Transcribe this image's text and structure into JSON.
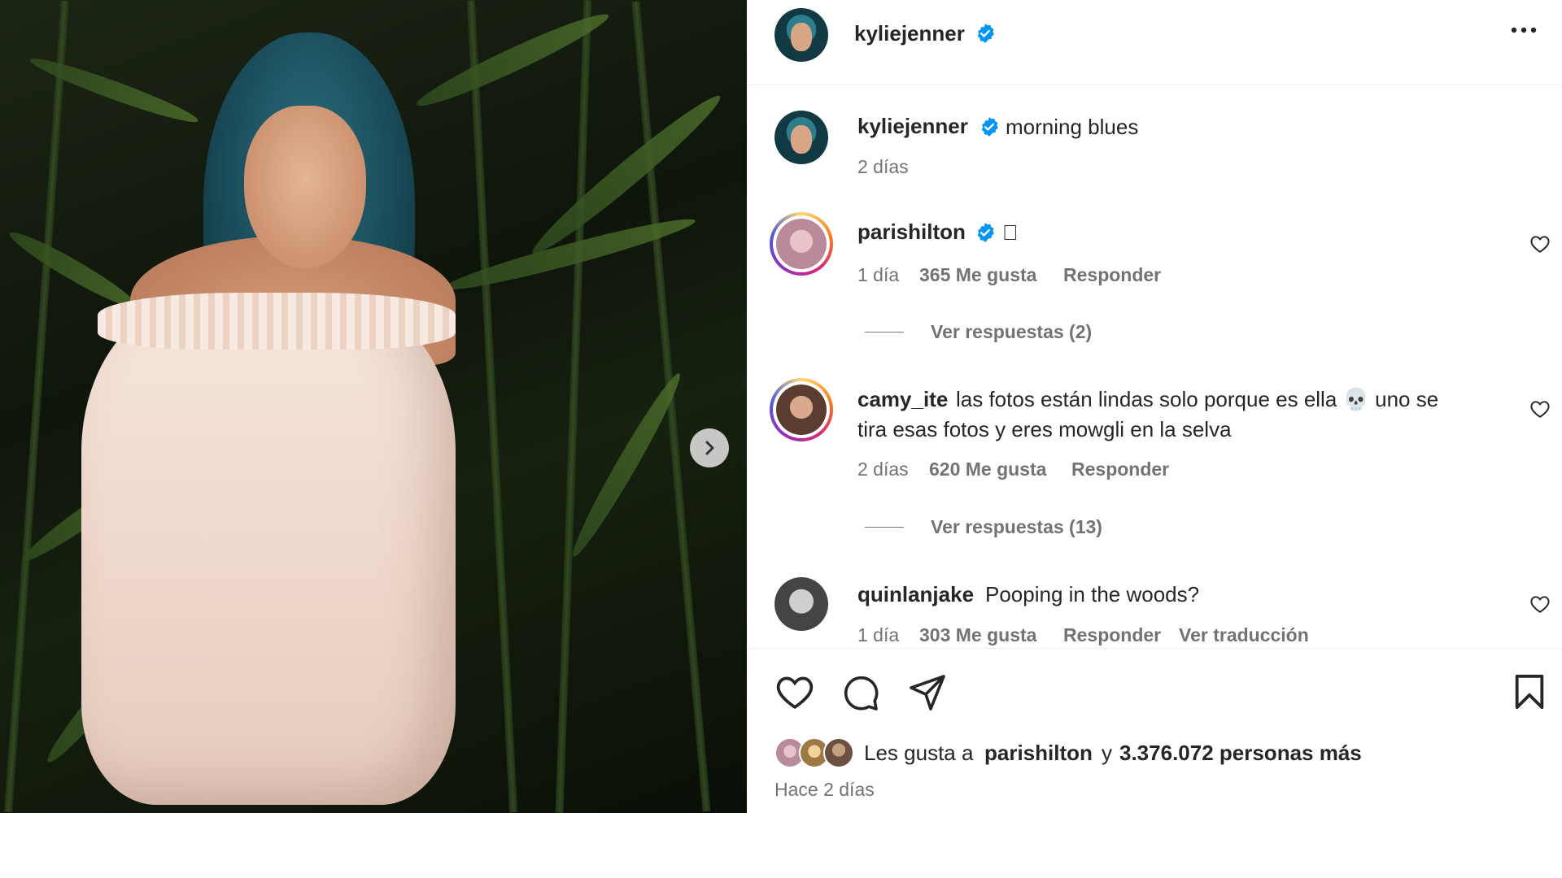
{
  "post": {
    "author": "kyliejenner",
    "caption": "morning blues",
    "caption_time": "2 días"
  },
  "comments": [
    {
      "user": "parishilton",
      "verified": true,
      "text": "",
      "time": "1 día",
      "likes": "365 Me gusta",
      "reply_label": "Responder",
      "view_replies": "Ver respuestas (2)"
    },
    {
      "user": "camy_ite",
      "verified": false,
      "text_line1": "las fotos están lindas solo porque es ella 💀 uno se",
      "text_line2": "tira esas fotos y eres mowgli en la selva",
      "time": "2 días",
      "likes": "620 Me gusta",
      "reply_label": "Responder",
      "view_replies": "Ver respuestas (13)"
    },
    {
      "user": "quinlanjake",
      "verified": false,
      "text": "Pooping in the woods?",
      "time": "1 día",
      "likes": "303 Me gusta",
      "reply_label": "Responder",
      "translate": "Ver traducción"
    }
  ],
  "likes_summary": {
    "prefix": "Les gusta a",
    "user": "parishilton",
    "joiner": "y",
    "count": "3.376.072 personas más"
  },
  "posted_ago": "Hace 2 días",
  "colors": {
    "verified": "#0095f6",
    "text": "#262626",
    "muted": "#737373",
    "divider": "#efefef"
  },
  "icons": {
    "more": "more-horizontal-icon",
    "like": "heart-icon",
    "comment": "comment-icon",
    "share": "send-icon",
    "save": "bookmark-icon",
    "next": "chevron-right-icon",
    "verified": "verified-badge-icon"
  }
}
